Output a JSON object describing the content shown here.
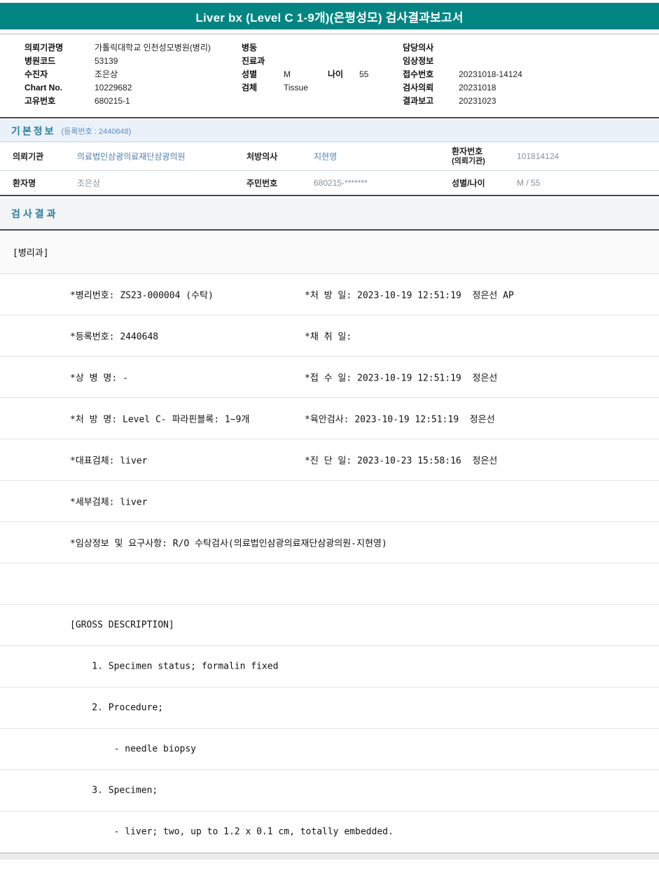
{
  "report": {
    "title": "Liver bx (Level C 1-9개)(은평성모) 검사결과보고서"
  },
  "patient_header": {
    "org_label": "의뢰기관명",
    "org_value": "가톨릭대학교 인천성모병원(병리)",
    "hospital_code_label": "병원코드",
    "hospital_code_value": "53139",
    "patient_label": "수진자",
    "patient_value": "조은상",
    "chart_label": "Chart No.",
    "chart_value": "10229682",
    "uid_label": "고유번호",
    "uid_value": "680215-1",
    "ward_label": "병동",
    "ward_value": "",
    "dept_label": "진료과",
    "dept_value": "",
    "sex_label": "성별",
    "sex_value": "M",
    "age_label": "나이",
    "age_value": "55",
    "specimen_label": "검체",
    "specimen_value": "Tissue",
    "doctor_label": "담당의사",
    "doctor_value": "",
    "clinical_label": "임상정보",
    "clinical_value": "",
    "accession_label": "접수번호",
    "accession_value": "20231018-14124",
    "request_label": "검사의뢰",
    "request_value": "20231018",
    "report_label": "결과보고",
    "report_value": "20231023"
  },
  "basic_info": {
    "title": "기본정보",
    "subtitle": "(등록번호 : 2440648)",
    "row1": {
      "c1_label": "의뢰기관",
      "c1_value": "의료법인삼광의료재단삼광의원",
      "c2_label": "처방의사",
      "c2_value": "지현영",
      "c3_label1": "환자번호",
      "c3_label2": "(의뢰기관)",
      "c3_value": "101814124"
    },
    "row2": {
      "c1_label": "환자명",
      "c1_value": "조은상",
      "c2_label": "주민번호",
      "c2_value": "680215-*******",
      "c3_label": "성별/나이",
      "c3_value": "M / 55"
    }
  },
  "results": {
    "title": "검사결과",
    "department": "[병리과]",
    "rows": [
      {
        "left": "*병리번호: ZS23-000004 (수탁)",
        "right": "*처 방 일: 2023-10-19 12:51:19  정은선 AP"
      },
      {
        "left": "*등록번호: 2440648",
        "right": "*채 취 일:"
      },
      {
        "left": "*상 병 명: -",
        "right": "*접 수 일: 2023-10-19 12:51:19  정은선"
      },
      {
        "left": "*처 방 명: Level C- 파라핀블록: 1~9개",
        "right": "*육안검사: 2023-10-19 12:51:19  정은선"
      },
      {
        "left": "*대표검체: liver",
        "right": "*진 단 일: 2023-10-23 15:58:16  정은선"
      },
      {
        "left": "*세부검체: liver",
        "right": ""
      },
      {
        "left": "*임상정보 및 요구사항: R/O 수탁검사(의료법인삼광의료재단삼광의원-지현영)",
        "right": ""
      },
      {
        "left": "",
        "right": ""
      },
      {
        "left": "[GROSS DESCRIPTION]",
        "right": ""
      },
      {
        "left": "    1. Specimen status; formalin fixed",
        "right": ""
      },
      {
        "left": "    2. Procedure;",
        "right": ""
      },
      {
        "left": "        - needle biopsy",
        "right": ""
      },
      {
        "left": "    3. Specimen;",
        "right": ""
      },
      {
        "left": "        - liver; two, up to 1.2 x 0.1 cm, totally embedded.",
        "right": ""
      }
    ]
  }
}
